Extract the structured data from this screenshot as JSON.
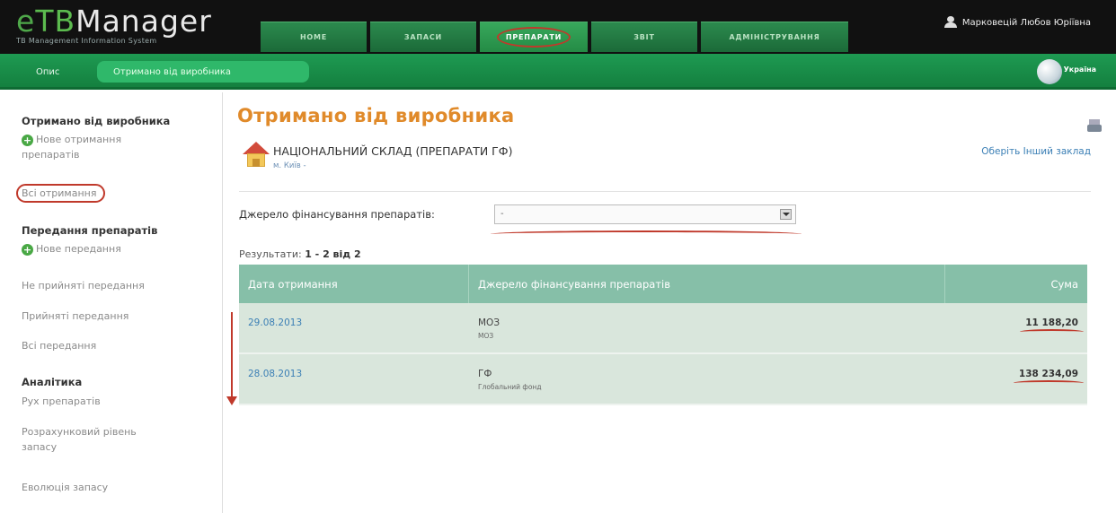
{
  "app": {
    "brand": "eTBManager",
    "brand_e": "e",
    "brand_tb": "TB",
    "brand_rest": "Manager",
    "subtitle": "TB Management Information System"
  },
  "main_nav": [
    {
      "label": "НОМЕ"
    },
    {
      "label": "ЗАПАСИ"
    },
    {
      "label": "ПРЕПАРАТИ",
      "active": true
    },
    {
      "label": "ЗВІТ"
    },
    {
      "label": "АДМІНІСТРУВАННЯ"
    }
  ],
  "user": {
    "name": "Марковецій Любов Юріївна",
    "icon": "user-icon"
  },
  "sub_nav": {
    "desk": "Опис",
    "active": "Отримано від виробника",
    "language": "Україна"
  },
  "sidebar": {
    "section1_title": "Отримано від виробника",
    "new_receiving_line1": "Нове отримання",
    "new_receiving_line2": "препаратів",
    "all_receivings": "Всі отримання",
    "section2_title": "Передання препаратів",
    "new_transfer": "Нове передання",
    "unaccepted_transfers": "Не прийняті передання",
    "accepted_transfers": "Прийняті передання",
    "all_transfers": "Всі передання",
    "section3_title": "Аналітика",
    "drug_movement": "Рух препаратів",
    "calc_level_line1": "Розрахунковий рівень",
    "calc_level_line2": "запасу",
    "stock_evolution": "Еволюція запасу"
  },
  "main": {
    "title": "Отримано від виробника",
    "unit_name": "НАЦІОНАЛЬНИЙ СКЛАД (ПРЕПАРАТИ ГФ)",
    "unit_city": "м. Київ -",
    "choose_unit": "Оберіть Інший заклад",
    "filter_label": "Джерело фінансування препаратів:",
    "filter_value": "-",
    "results_label": "Результати:",
    "results_value": "1 - 2 від 2"
  },
  "table": {
    "headers": [
      "Дата отримання",
      "Джерело фінансування препаратів",
      "Сума"
    ],
    "rows": [
      {
        "date": "29.08.2013",
        "source": "МОЗ",
        "source_sub": "МОЗ",
        "sum": "11 188,20"
      },
      {
        "date": "28.08.2013",
        "source": "ГФ",
        "source_sub": "Глобальний фонд",
        "sum": "138 234,09"
      }
    ]
  },
  "colors": {
    "accent_orange": "#e08a2a",
    "nav_green": "#1e9a52",
    "annotation_red": "#c0392b"
  }
}
